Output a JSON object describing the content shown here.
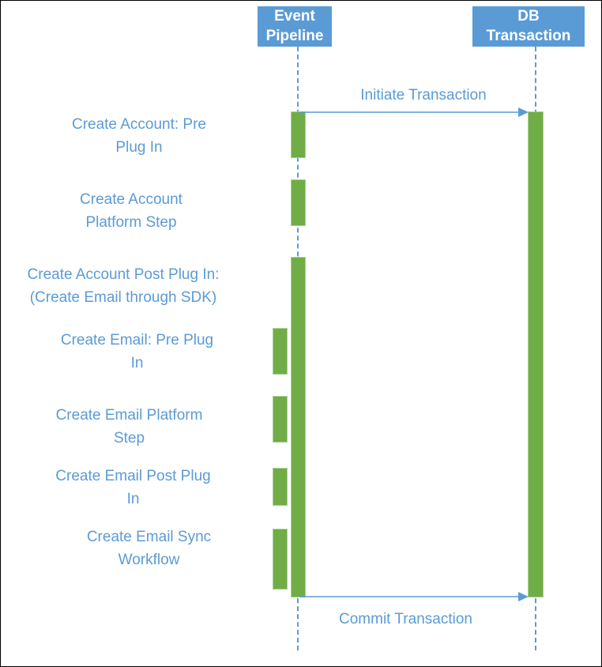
{
  "diagram": {
    "type": "sequence",
    "colors": {
      "header_fill": "#5b9bd5",
      "header_text": "#ffffff",
      "lifeline": "#5b9bd5",
      "activation": "#70ad47",
      "label_text": "#5b9bd5"
    },
    "participants": [
      {
        "id": "event",
        "title_line1": "Event",
        "title_line2": "Pipeline"
      },
      {
        "id": "db",
        "title_line1": "DB",
        "title_line2": "Transaction"
      }
    ],
    "messages": [
      {
        "label": "Initiate Transaction",
        "from": "event",
        "to": "db"
      },
      {
        "label": "Commit Transaction",
        "from": "event",
        "to": "db"
      }
    ],
    "steps": [
      {
        "line1": "Create Account: Pre",
        "line2": "Plug In"
      },
      {
        "line1": "Create Account",
        "line2": "Platform Step"
      },
      {
        "line1": "Create Account Post Plug In:",
        "line2": "(Create Email through SDK)"
      },
      {
        "line1": "Create Email: Pre Plug",
        "line2": "In"
      },
      {
        "line1": "Create Email Platform",
        "line2": "Step"
      },
      {
        "line1": "Create Email Post Plug",
        "line2": "In"
      },
      {
        "line1": "Create Email Sync",
        "line2": "Workflow"
      }
    ]
  }
}
